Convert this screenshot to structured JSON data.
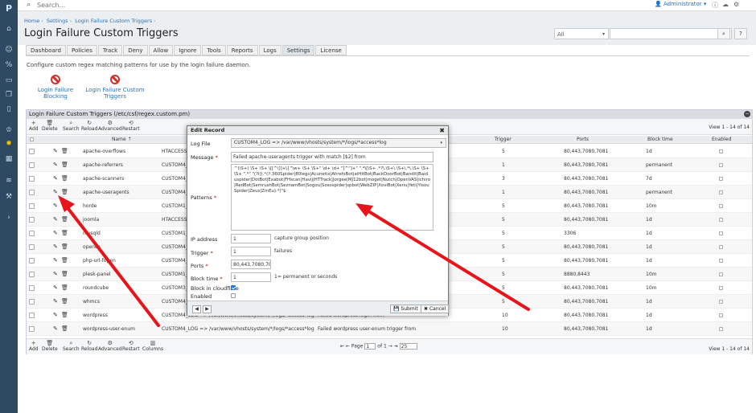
{
  "topbar": {
    "search_placeholder": "Search...",
    "user": "Administrator",
    "user_caret": "▾"
  },
  "breadcrumb": [
    "Home",
    "Settings",
    "Login Failure Custom Triggers"
  ],
  "page_title": "Login Failure Custom Triggers",
  "header": {
    "filter_value": "All",
    "search_value": ""
  },
  "tabs": [
    "Dashboard",
    "Policies",
    "Track",
    "Deny",
    "Allow",
    "Ignore",
    "Tools",
    "Reports",
    "Logs",
    "Settings",
    "License"
  ],
  "active_tab": "Settings",
  "description": "Configure custom regex matching patterns for use by the login failure daemon.",
  "actions": [
    {
      "line1": "Login Failure",
      "line2": "Blocking"
    },
    {
      "line1": "Login Failure Custom",
      "line2": "Triggers"
    }
  ],
  "panel": {
    "title": "Login Failure Custom Triggers (/etc/csf/regex.custom.pm)",
    "toolbar": [
      "Add",
      "Delete",
      "Search",
      "Reload",
      "Advanced",
      "Restart"
    ],
    "footer_toolbar": [
      "Add",
      "Delete",
      "Search",
      "Reload",
      "Advanced",
      "Restart",
      "Columns"
    ],
    "view_info": "View 1 - 14 of 14",
    "columns": {
      "name": "Name ⇡",
      "trigger": "Trigger",
      "ports": "Ports",
      "block_time": "Block time",
      "enabled": "Enabled"
    },
    "rows": [
      {
        "name": "apache-overflows",
        "log": "HTACCESS_L",
        "message": "",
        "trigger": "5",
        "ports": "80,443,7080,7081",
        "block": "1d"
      },
      {
        "name": "apache-referrers",
        "log": "CUSTOM4_L",
        "message": "",
        "trigger": "1",
        "ports": "80,443,7080,7081",
        "block": "permanent"
      },
      {
        "name": "apache-scanners",
        "log": "CUSTOM4_L",
        "message": "",
        "trigger": "3",
        "ports": "80,443,7080,7081",
        "block": "7d"
      },
      {
        "name": "apache-useragents",
        "log": "CUSTOM4_L",
        "message": "",
        "trigger": "1",
        "ports": "80,443,7080,7081",
        "block": "permanent"
      },
      {
        "name": "horde",
        "log": "CUSTOM1_L",
        "message": "",
        "trigger": "5",
        "ports": "80,443,7080,7081",
        "block": "10m"
      },
      {
        "name": "joomla",
        "log": "HTACCESS_L",
        "message": "",
        "trigger": "5",
        "ports": "80,443,7080,7081",
        "block": "1d"
      },
      {
        "name": "mysqld",
        "log": "CUSTOM1_L",
        "message": "",
        "trigger": "5",
        "ports": "3306",
        "block": "1d"
      },
      {
        "name": "openca",
        "log": "CUSTOM4_L",
        "message": "",
        "trigger": "5",
        "ports": "80,443,7080,7081",
        "block": "1d"
      },
      {
        "name": "php-url-fopen",
        "log": "CUSTOM4_L",
        "message": "",
        "trigger": "5",
        "ports": "80,443,7080,7081",
        "block": "1d"
      },
      {
        "name": "plesk-panel",
        "log": "CUSTOM1_L",
        "message": "",
        "trigger": "5",
        "ports": "8880,8443",
        "block": "10m"
      },
      {
        "name": "roundcube",
        "log": "CUSTOM3_L",
        "message": "",
        "trigger": "5",
        "ports": "80,443,7080,7081",
        "block": "10m"
      },
      {
        "name": "whmcs",
        "log": "CUSTOM4_L",
        "message": "",
        "trigger": "5",
        "ports": "80,443,7080,7081",
        "block": "1d"
      },
      {
        "name": "wordpress",
        "log": "CUSTOM4_LOG => /var/www/vhosts/system/*/logs/*access*log",
        "message": "Failed wordpress login from",
        "trigger": "10",
        "ports": "80,443,7080,7081",
        "block": "1d"
      },
      {
        "name": "wordpress-user-enum",
        "log": "CUSTOM4_LOG => /var/www/vhosts/system/*/logs/*access*log",
        "message": "Failed wordpress user-enum trigger from",
        "trigger": "10",
        "ports": "80,443,7080,7081",
        "block": "1d"
      }
    ],
    "pager": {
      "page_label": "Page",
      "page": "1",
      "of": "of 1",
      "per_page": "25"
    }
  },
  "modal": {
    "title": "Edit Record",
    "labels": {
      "log_file": "Log File",
      "message": "Message",
      "patterns": "Patterns",
      "ip": "IP address",
      "trigger": "Trigger",
      "ports": "Ports",
      "block_time": "Block time",
      "cloudflare": "Block in cloudflare",
      "enabled": "Enabled"
    },
    "log_file": "CUSTOM4_LOG => /var/www/vhosts/system/*/logs/*access*log",
    "message": "Failed apache-useragents trigger with match [$2] from",
    "patterns": "^(\\S+) \\S+ \\S+ \\[[^\\]]+\\] \"\\w+ \\S+ \\S+\" \\d+ \\d+ \"[^\"]+\" \".*\\[\\S+ .*?\\.\\S+\\.\\S+\\.*\\.\\S+ \\S+ \\S+ \".*\" \"(?i)(.*(?:360Spider|80legs|Acunetix|AhrefsBot|aiHitBot|BackDoorBot|Bandit|Baiduspider|DotBot|Exabot|FHscan|Havij|HTTrack|Jorgee|MJ12bot|moget|Nutch|OpenVAS|ichiro|RedBot|SemrushBot|SeznamBot|Sogou|Sosospider|spbot|WebZIP|XoviBot|Xenu|Yeti|YisouSpider|Zeus|ZmEu).*)\"$",
    "ip": "1",
    "ip_note": "capture group position",
    "trigger": "1",
    "trigger_note": "failures",
    "ports": "80,443,7080,7081",
    "block_time": "1",
    "block_note": "1= permanent or seconds",
    "cloudflare": true,
    "enabled": false,
    "submit": "Submit",
    "cancel": "Cancel"
  }
}
